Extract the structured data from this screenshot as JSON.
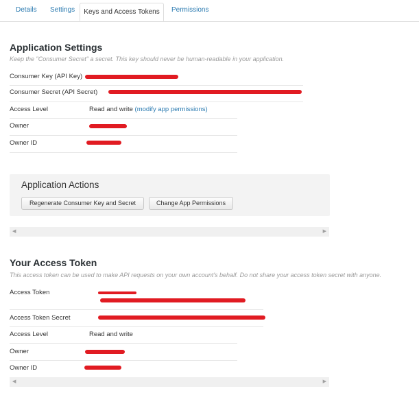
{
  "tabs": [
    {
      "label": "Details"
    },
    {
      "label": "Settings"
    },
    {
      "label": "Keys and Access Tokens",
      "active": true
    },
    {
      "label": "Permissions"
    }
  ],
  "app_settings": {
    "title": "Application Settings",
    "description": "Keep the \"Consumer Secret\" a secret. This key should never be human-readable in your application.",
    "rows": {
      "consumer_key": "Consumer Key (API Key)",
      "consumer_secret": "Consumer Secret (API Secret)",
      "access_level": "Access Level",
      "access_level_value": "Read and write",
      "access_level_link": "(modify app permissions)",
      "owner": "Owner",
      "owner_id": "Owner ID"
    }
  },
  "app_actions": {
    "title": "Application Actions",
    "regenerate_button": "Regenerate Consumer Key and Secret",
    "change_permissions_button": "Change App Permissions"
  },
  "access_token": {
    "title": "Your Access Token",
    "description": "This access token can be used to make API requests on your own account's behalf. Do not share your access token secret with anyone.",
    "rows": {
      "access_token": "Access Token",
      "access_token_secret": "Access Token Secret",
      "access_level": "Access Level",
      "access_level_value": "Read and write",
      "owner": "Owner",
      "owner_id": "Owner ID"
    }
  },
  "colors": {
    "link": "#2a7ab0",
    "redaction": "#e11b22",
    "panel": "#f3f3f3"
  },
  "icons": [
    "scroll-left-icon",
    "scroll-right-icon"
  ]
}
